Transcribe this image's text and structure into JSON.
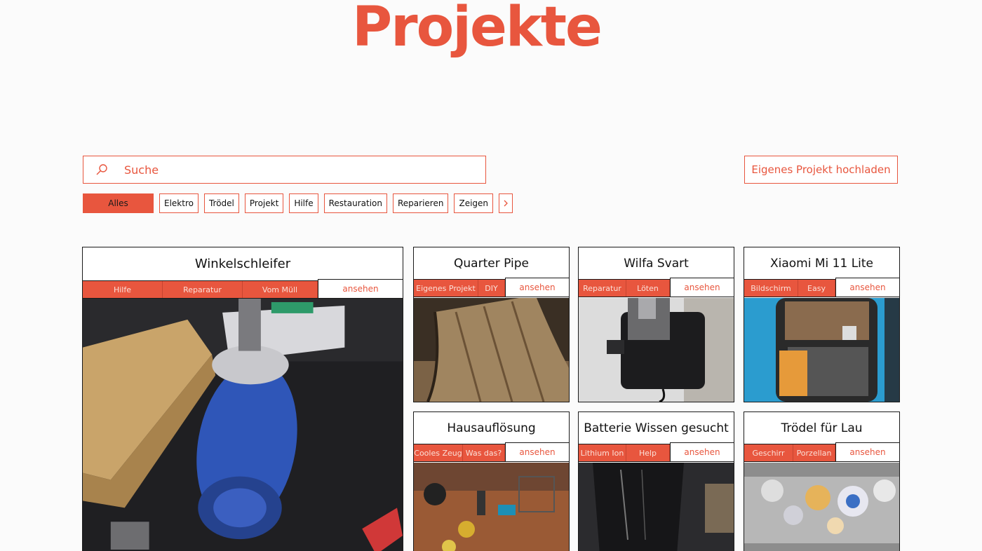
{
  "page": {
    "title": "Projekte"
  },
  "search": {
    "placeholder": "Suche",
    "icon": "search-icon"
  },
  "upload": {
    "label": "Eigenes Projekt hochladen"
  },
  "filters": {
    "items": [
      "Alles",
      "Elektro",
      "Trödel",
      "Projekt",
      "Hilfe",
      "Restauration",
      "Reparieren",
      "Zeigen"
    ],
    "active": "Alles",
    "next_icon": "chevron-right-icon"
  },
  "colors": {
    "accent": "#e8563e",
    "border": "#1a1a1a",
    "background": "#fbfbfb"
  },
  "projects": [
    {
      "title": "Winkelschleifer",
      "tags": [
        "Hilfe",
        "Reparatur",
        "Vom Müll"
      ],
      "view_label": "ansehen"
    },
    {
      "title": "Quarter Pipe",
      "tags": [
        "Eigenes Projekt",
        "DIY"
      ],
      "view_label": "ansehen"
    },
    {
      "title": "Wilfa Svart",
      "tags": [
        "Reparatur",
        "Löten"
      ],
      "view_label": "ansehen"
    },
    {
      "title": "Xiaomi Mi 11 Lite",
      "tags": [
        "Bildschirm",
        "Easy"
      ],
      "view_label": "ansehen"
    },
    {
      "title": "Hausauflösung",
      "tags": [
        "Cooles Zeug",
        "Was das?"
      ],
      "view_label": "ansehen"
    },
    {
      "title": "Batterie Wissen gesucht",
      "tags": [
        "Lithium Ion",
        "Help"
      ],
      "view_label": "ansehen"
    },
    {
      "title": "Trödel für Lau",
      "tags": [
        "Geschirr",
        "Porzellan"
      ],
      "view_label": "ansehen"
    }
  ]
}
